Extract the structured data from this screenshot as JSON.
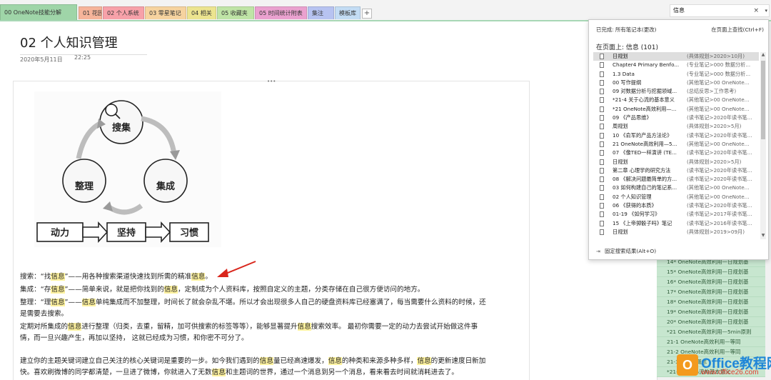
{
  "tabs": [
    {
      "label": "00 OneNote技能分解",
      "color": "#9fd5a8",
      "active": true
    },
    {
      "label": "01 花园",
      "color": "#f6b49a"
    },
    {
      "label": "02 个人系统",
      "color": "#f7a1a9"
    },
    {
      "label": "03 零星笔记",
      "color": "#f6d39f"
    },
    {
      "label": "04 相关",
      "color": "#ece48f"
    },
    {
      "label": "05 收藏夹",
      "color": "#bfe4a6"
    },
    {
      "label": "05 时间统计附表",
      "color": "#eaa1cf"
    },
    {
      "label": "集注",
      "color": "#b7c3f1"
    },
    {
      "label": "模板库",
      "color": "#c3dcf4"
    }
  ],
  "add_tab": "+",
  "search": {
    "query": "信息",
    "clear": "×",
    "dropdown": "▾"
  },
  "page": {
    "title": "02 个人知识管理",
    "date": "2020年5月11日",
    "time": "22:25",
    "handle": "•••"
  },
  "image_labels": {
    "search": "搜集",
    "organize": "整理",
    "integrate": "集成",
    "motivation": "动力",
    "persist": "坚持",
    "habit": "习惯"
  },
  "paragraphs": [
    {
      "parts": [
        [
          "搜索：“找",
          0
        ],
        [
          "信息",
          1
        ],
        [
          "”——用各种搜索渠道快速找到所需的精准",
          0
        ],
        [
          "信息",
          1
        ],
        [
          "。",
          0
        ]
      ]
    },
    {
      "parts": [
        [
          "集成：“存",
          0
        ],
        [
          "信息",
          1
        ],
        [
          "”——简单来说，就是把你找到的",
          0
        ],
        [
          "信息",
          1
        ],
        [
          "，定制成为个人资料库，按照自定义的主题，分类存储在自己很方便访问的地方。",
          0
        ]
      ]
    },
    {
      "parts": [
        [
          " 整理：“理",
          0
        ],
        [
          "信息",
          1
        ],
        [
          "”——",
          0
        ],
        [
          "信息",
          1
        ],
        [
          "单纯集成而不加整理，时间长了就会杂乱不堪。所以才会出现很多人自己的硬盘资料库已经塞满了，每当需要什么资料的时候，还",
          0
        ]
      ]
    },
    {
      "parts": [
        [
          "是需要去搜索。",
          0
        ]
      ]
    },
    {
      "parts": [
        [
          "定期对所集成的",
          0
        ],
        [
          "信息",
          1
        ],
        [
          "进行整理（归类，去重，留精，加可供搜索的标签等等），能够显著提升",
          0
        ],
        [
          "信息",
          1
        ],
        [
          "搜索效率。 最初你需要一定的动力去尝试开始做这件事",
          0
        ]
      ]
    },
    {
      "parts": [
        [
          "情，而一旦兴趣产生，再加以坚持， 这就已经成为习惯，和你密不可分了。",
          0
        ]
      ]
    },
    {
      "parts": [
        [
          "",
          0
        ]
      ]
    },
    {
      "parts": [
        [
          "建立你的主题关键词建立自己关注的核心关键词是重要的一步。如今我们遇到的",
          0
        ],
        [
          "信息",
          1
        ],
        [
          "量已经高速爆发，",
          0
        ],
        [
          "信息",
          1
        ],
        [
          "的种类和来源多种多样，",
          0
        ],
        [
          "信息",
          1
        ],
        [
          "的更新速度日新加",
          0
        ]
      ]
    },
    {
      "parts": [
        [
          "快。喜欢刷微博的同学都清楚，一旦进了微博，你就进入了无数",
          0
        ],
        [
          "信息",
          1
        ],
        [
          "和主题词的世界，通过一个消息到另一个消息，看来看去时间就消耗进去了。",
          0
        ]
      ]
    }
  ],
  "panel": {
    "scope": "已完成: 所有笔记本(更改)",
    "find_on_page": "在页面上查找(Ctrl+F)",
    "heading": "在页面上: 信息 (101)",
    "pin": "固定搜索结果(Alt+O)",
    "pin_icon": "⇥",
    "results": [
      {
        "title": "日规划",
        "path": "(具体规划>2020>10月)"
      },
      {
        "title": "Chapter4 Primary Benfo...",
        "path": "(专业笔记>000 数据分析..."
      },
      {
        "title": "1.3 Data",
        "path": "(专业笔记>000 数据分析..."
      },
      {
        "title": "00 写作提纲",
        "path": "(其他笔记>00 OneNote..."
      },
      {
        "title": "09 对数据分析与挖掘领域...",
        "path": "(总结反思>工作思考)"
      },
      {
        "title": "*21-4 关于心流的基本意义",
        "path": "(其他笔记>00 OneNote..."
      },
      {
        "title": "*21 OneNote高效利用—...",
        "path": "(其他笔记>00 OneNote..."
      },
      {
        "title": "09 《产品思维》",
        "path": "(读书笔记>2020年读书笔..."
      },
      {
        "title": "周规划",
        "path": "(具体规划>2020>5月)"
      },
      {
        "title": "10 《俞军的产品方法论》",
        "path": "(读书笔记>2020年读书笔..."
      },
      {
        "title": "21 OneNote高效利用—5...",
        "path": "(其他笔记>00 OneNote..."
      },
      {
        "title": "07 《像TED一样演讲 (TE...",
        "path": "(读书笔记>2020年读书笔..."
      },
      {
        "title": "日规划",
        "path": "(具体规划>2020>5月)"
      },
      {
        "title": "第二章 心理学的研究方法",
        "path": "(读书笔记>2020年读书笔..."
      },
      {
        "title": "08 《解决问题最简单的方...",
        "path": "(读书笔记>2020年读书笔..."
      },
      {
        "title": "03 如何构建自己的笔记系...",
        "path": "(其他笔记>00 OneNote..."
      },
      {
        "title": "02 个人知识管理",
        "path": "(其他笔记>00 OneNote..."
      },
      {
        "title": "06 《获得的本质》",
        "path": "(读书笔记>2020年读书笔..."
      },
      {
        "title": "01-19 《如何学习》",
        "path": "(读书笔记>2017年读书笔..."
      },
      {
        "title": "15 《上帝掷骰子吗》笔记",
        "path": "(读书笔记>2016年读书笔..."
      },
      {
        "title": "日规划",
        "path": "(具体规划>2019>09月)"
      }
    ]
  },
  "right_list": [
    "14* OneNote高效利用—日规划基",
    "15* OneNote高效利用—日规划基",
    "16* OneNote高效利用—日规划基",
    "17* OneNote高效利用—日规划基",
    "18* OneNote高效利用—日规划基",
    "19* OneNote高效利用—日规划基",
    "20* OneNote高效利用—日规划基",
    "*21 OneNote高效利用—5min原则",
    "21-1 OneNote高效利用—等同",
    "21-2 OneNote高效利用—等同",
    "21-3 心流的概念",
    "*21-4 关于心流的基本意义"
  ],
  "watermark": {
    "icon": "O",
    "title": "Office教程网",
    "url": "www.office26.com"
  },
  "colors": {
    "highlight": "#fff3a0",
    "accent_green": "#a8d7b5",
    "arrow": "#d9261c"
  }
}
